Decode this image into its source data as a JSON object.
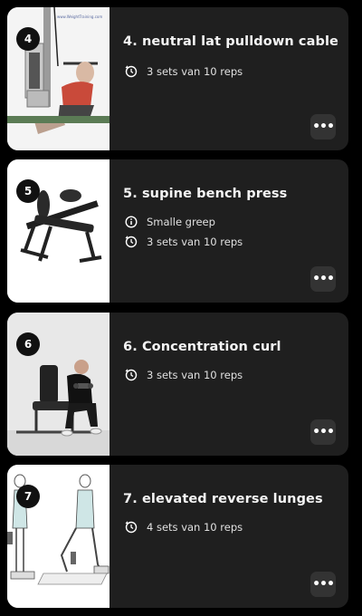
{
  "exercises": [
    {
      "number": "4",
      "title": "4. neutral lat pulldown cable",
      "info": null,
      "sets": "3 sets van 10 reps",
      "image": "lat-pulldown-illustration",
      "watermark": "www.WeightTraining.com"
    },
    {
      "number": "5",
      "title": "5. supine bench press",
      "info": "Smalle greep",
      "sets": "3 sets van 10 reps",
      "image": "bench-press-machine"
    },
    {
      "number": "6",
      "title": "6. Concentration curl",
      "info": null,
      "sets": "3 sets van 10 reps",
      "image": "concentration-curl-photo"
    },
    {
      "number": "7",
      "title": "7. elevated reverse lunges",
      "info": null,
      "sets": "4 sets van 10 reps",
      "image": "reverse-lunge-illustration"
    }
  ],
  "icons": {
    "info": "info-circle-icon",
    "sets": "repeat-timer-icon",
    "more": "more-horizontal-icon"
  },
  "colors": {
    "background": "#000000",
    "card": "#1f1f1f",
    "more_button": "#333333",
    "badge": "#111111"
  }
}
